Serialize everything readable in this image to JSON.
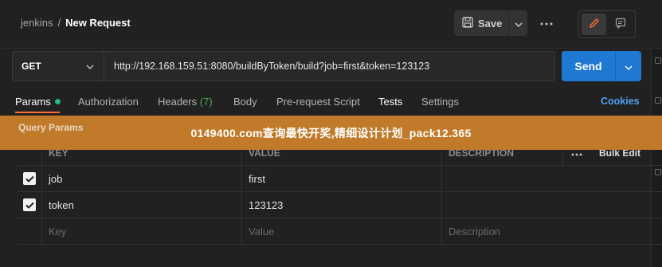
{
  "header": {
    "workspace": "jenkins",
    "separator": "/",
    "title": "New Request",
    "save_label": "Save"
  },
  "request": {
    "method": "GET",
    "url": "http://192.168.159.51:8080/buildByToken/build?job=first&token=123123",
    "send_label": "Send"
  },
  "tabs": [
    {
      "label": "Params"
    },
    {
      "label": "Authorization"
    },
    {
      "label": "Headers",
      "count": "(7)"
    },
    {
      "label": "Body"
    },
    {
      "label": "Pre-request Script"
    },
    {
      "label": "Tests"
    },
    {
      "label": "Settings"
    }
  ],
  "cookies_label": "Cookies",
  "banner_text": "0149400.com查询最快开奖,精细设计计划_pack12.365",
  "query_params_label": "Query Params",
  "table": {
    "headers": {
      "key": "KEY",
      "value": "VALUE",
      "description": "DESCRIPTION",
      "bulk_edit": "Bulk Edit"
    },
    "rows": [
      {
        "checked": true,
        "key": "job",
        "value": "first",
        "description": ""
      },
      {
        "checked": true,
        "key": "token",
        "value": "123123",
        "description": ""
      }
    ],
    "placeholders": {
      "key": "Key",
      "value": "Value",
      "description": "Description"
    }
  },
  "colors": {
    "send": "#1f78d1",
    "active_tab_underline": "#ff6c37",
    "params_dot": "#26b47f",
    "headers_count": "#4caf50",
    "cookies": "#4e9ff2",
    "banner": "#c07a2a"
  },
  "icons": [
    "save-icon",
    "chevron-down-icon",
    "more-horizontal-icon",
    "pencil-icon",
    "comment-icon",
    "checkbox-checked-icon"
  ]
}
